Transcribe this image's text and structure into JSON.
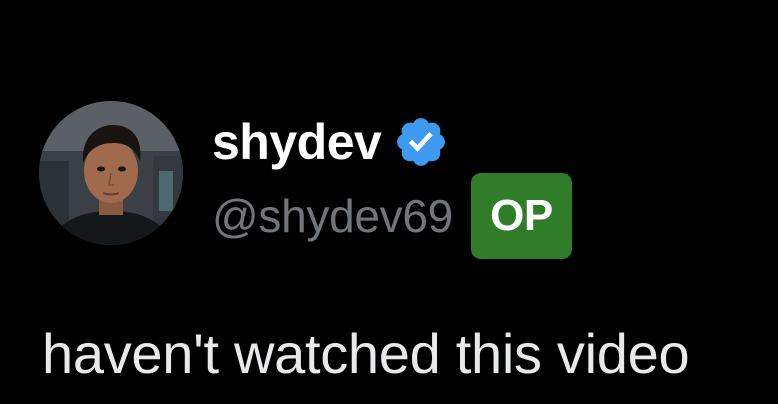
{
  "post": {
    "author": {
      "display_name": "shydev",
      "handle": "@shydev69",
      "verified": true,
      "avatar": "avatar-photo",
      "op_badge": "OP"
    },
    "text": "haven't watched this video"
  },
  "colors": {
    "background": "#000000",
    "display_name": "#ffffff",
    "handle": "#71767b",
    "verified_badge": "#3d9af0",
    "op_badge_bg": "#2f7d28",
    "body_text": "#e7e9ea"
  },
  "icons": {
    "verified": "verified-badge-icon"
  }
}
